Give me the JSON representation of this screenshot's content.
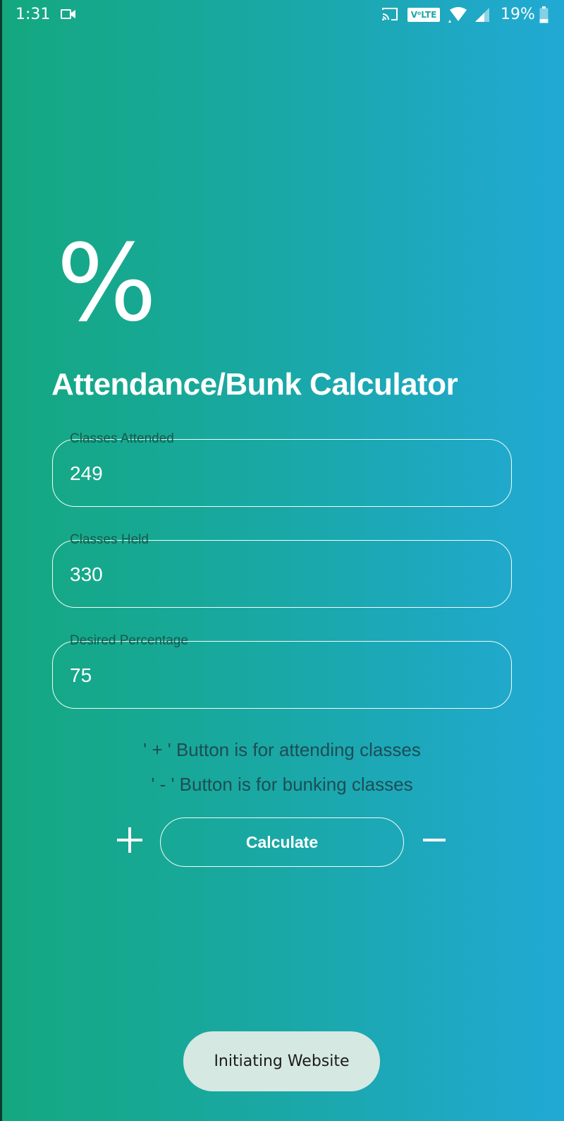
{
  "status_bar": {
    "time": "1:31",
    "volte": "V⁰LTE",
    "battery": "19%"
  },
  "app": {
    "icon": "percent-icon",
    "icon_glyph": "%",
    "title": "Attendance/Bunk Calculator"
  },
  "form": {
    "classes_attended": {
      "label": "Classes Attended",
      "value": "249"
    },
    "classes_held": {
      "label": "Classes Held",
      "value": "330"
    },
    "desired_percentage": {
      "label": "Desired Percentage",
      "value": "75"
    }
  },
  "hints": {
    "plus": "' + '  Button is for attending classes",
    "minus": "' - '  Button is for bunking classes"
  },
  "actions": {
    "calculate_label": "Calculate",
    "plus_icon": "plus-icon",
    "minus_icon": "minus-icon"
  },
  "toast": {
    "message": "Initiating Website"
  },
  "colors": {
    "gradient_start": "#14a87f",
    "gradient_end": "#21a9d4",
    "label_color": "#17594c",
    "hint_color": "#1d4d55",
    "toast_bg": "#d6e8e2"
  }
}
